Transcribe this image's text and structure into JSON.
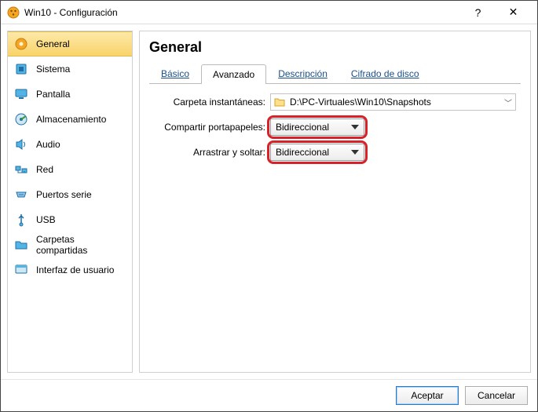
{
  "window": {
    "title": "Win10 - Configuración",
    "help": "?",
    "close": "✕"
  },
  "sidebar": {
    "items": [
      {
        "label": "General"
      },
      {
        "label": "Sistema"
      },
      {
        "label": "Pantalla"
      },
      {
        "label": "Almacenamiento"
      },
      {
        "label": "Audio"
      },
      {
        "label": "Red"
      },
      {
        "label": "Puertos serie"
      },
      {
        "label": "USB"
      },
      {
        "label": "Carpetas compartidas"
      },
      {
        "label": "Interfaz de usuario"
      }
    ]
  },
  "main": {
    "heading": "General",
    "tabs": {
      "basic": "Básico",
      "advanced": "Avanzado",
      "description": "Descripción",
      "disk_encryption": "Cifrado de disco"
    },
    "active_tab": "advanced",
    "form": {
      "snapshot_folder_label": "Carpeta instantáneas:",
      "snapshot_folder_value": "D:\\PC-Virtuales\\Win10\\Snapshots",
      "clipboard_label": "Compartir portapapeles:",
      "clipboard_value": "Bidireccional",
      "dragdrop_label": "Arrastrar y soltar:",
      "dragdrop_value": "Bidireccional"
    }
  },
  "footer": {
    "accept": "Aceptar",
    "cancel": "Cancelar"
  }
}
